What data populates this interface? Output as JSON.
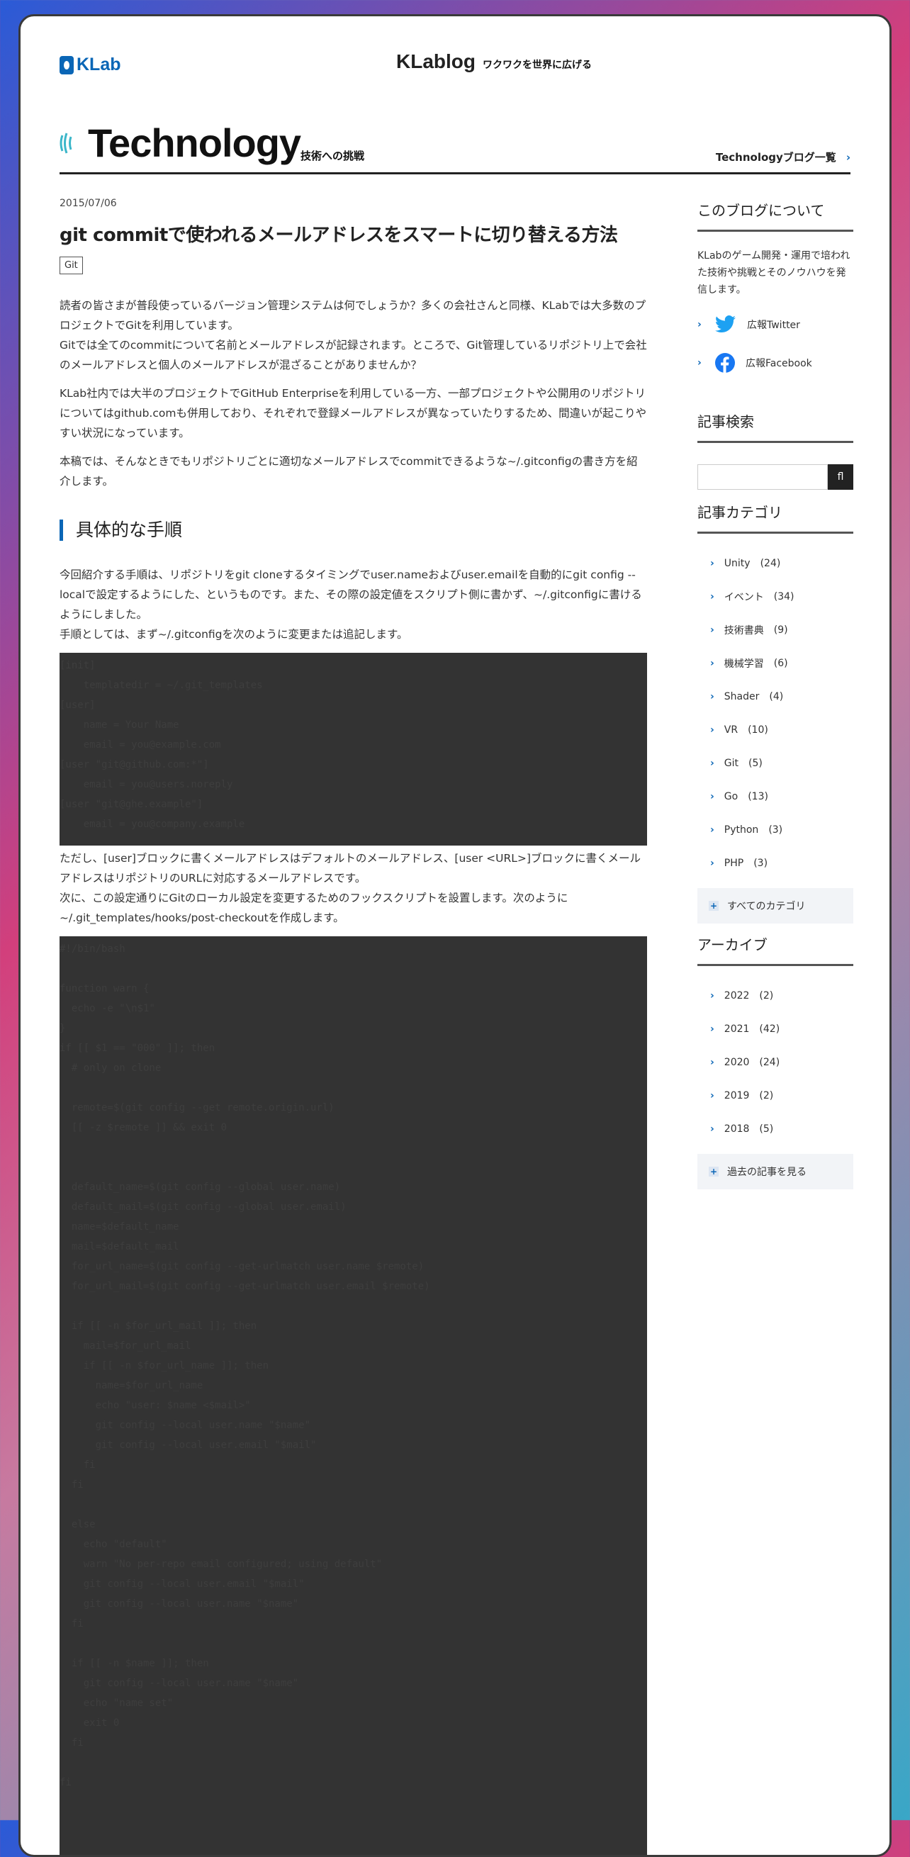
{
  "header": {
    "klab_logo": "KLab",
    "klablog_logo": "KLablog",
    "klablog_tagline": "ワクワクを世界に広げる"
  },
  "hero": {
    "title": "Technology",
    "subtitle": "技術への挑戦",
    "list_link": "Technologyブログ一覧"
  },
  "article": {
    "date": "2015/07/06",
    "title": "git commitで使われるメールアドレスをスマートに切り替える方法",
    "tag": "Git",
    "intro": [
      "読者の皆さまが普段使っているバージョン管理システムは何でしょうか？多くの会社さんと同様、KLabでは大多数のプロジェクトでGitを利用しています。",
      "Gitでは全てのcommitについて名前とメールアドレスが記録されます。ところで、Git管理しているリポジトリ上で会社のメールアドレスと個人のメールアドレスが混ざることがありませんか？",
      "KLab社内では大半のプロジェクトでGitHub Enterpriseを利用している一方、一部プロジェクトや公開用のリポジトリについてはgithub.comも併用しており、それぞれで登録メールアドレスが異なっていたりするため、間違いが起こりやすい状況になっています。",
      "本稿では、そんなときでもリポジトリごとに適切なメールアドレスでcommitできるような~/.gitconfigの書き方を紹介します。"
    ],
    "h2": "具体的な手順",
    "steps": [
      "今回紹介する手順は、リポジトリをgit cloneするタイミングでuser.nameおよびuser.emailを自動的にgit config --localで設定するようにした、というものです。また、その際の設定値をスクリプト側に書かず、~/.gitconfigに書けるようにしました。",
      "手順としては、まず~/.gitconfigを次のように変更または追記します。"
    ],
    "after_code": [
      "ただし、[user]ブロックに書くメールアドレスはデフォルトのメールアドレス、[user <URL>]ブロックに書くメールアドレスはリポジトリのURLに対応するメールアドレスです。",
      "次に、この設定通りにGitのローカル設定を変更するためのフックスクリプトを設置します。次のように~/.git_templates/hooks/post-checkoutを作成します。"
    ],
    "code1": [
      "[init]",
      "    templatedir = ~/.git_templates",
      "[user]",
      "    name = Your Name",
      "    email = you@example.com",
      "[user \"git@github.com:*\"]",
      "    email = you@users.noreply",
      "[user \"git@ghe.example\"]",
      "    email = you@company.example"
    ],
    "code2": [
      "#!/bin/bash",
      "",
      "function warn {",
      "  echo -e \"\\n$1\"",
      "}",
      "if [[ $1 == \"000\" ]]; then",
      "  # only on clone",
      "",
      "  remote=$(git config --get remote.origin.url)",
      "  [[ -z $remote ]] && exit 0",
      "",
      "  ",
      "  default_name=$(git config --global user.name)",
      "  default_mail=$(git config --global user.email)",
      "  name=$default_name",
      "  mail=$default_mail",
      "  for_url_name=$(git config --get-urlmatch user.name $remote)",
      "  for_url_mail=$(git config --get-urlmatch user.email $remote)",
      "",
      "  if [[ -n $for_url_mail ]]; then",
      "    mail=$for_url_mail",
      "    if [[ -n $for_url_name ]]; then",
      "      name=$for_url_name",
      "      echo \"user: $name <$mail>\"",
      "      git config --local user.name \"$name\"",
      "      git config --local user.email \"$mail\"",
      "    fi",
      "  fi",
      "",
      "  else",
      "    echo \"default\"",
      "    warn \"No per-repo email configured; using default\"",
      "    git config --local user.email \"$mail\"",
      "    git config --local user.name \"$name\"",
      "  fi",
      "",
      "  if [[ -n $name ]]; then",
      "    git config --local user.name \"$name\"",
      "    echo \"name set\"",
      "    exit 0",
      "  fi",
      "",
      "fi"
    ]
  },
  "sidebar": {
    "about_heading": "このブログについて",
    "about_text": "KLabのゲーム開発・運用で培われた技術や挑戦とそのノウハウを発信します。",
    "twitter_label": "広報Twitter",
    "facebook_label": "広報Facebook",
    "search_heading": "記事検索",
    "search_button": "fl",
    "category_heading": "記事カテゴリ",
    "categories": [
      {
        "name": "Unity",
        "count": "(24)"
      },
      {
        "name": "イベント",
        "count": "(34)"
      },
      {
        "name": "技術書典",
        "count": "(9)"
      },
      {
        "name": "機械学習",
        "count": "(6)"
      },
      {
        "name": "Shader",
        "count": "(4)"
      },
      {
        "name": "VR",
        "count": "(10)"
      },
      {
        "name": "Git",
        "count": "(5)"
      },
      {
        "name": "Go",
        "count": "(13)"
      },
      {
        "name": "Python",
        "count": "(3)"
      },
      {
        "name": "PHP",
        "count": "(3)"
      }
    ],
    "all_categories": "すべてのカテゴリ",
    "archive_heading": "アーカイブ",
    "archives": [
      {
        "year": "2022",
        "count": "(2)"
      },
      {
        "year": "2021",
        "count": "(42)"
      },
      {
        "year": "2020",
        "count": "(24)"
      },
      {
        "year": "2019",
        "count": "(2)"
      },
      {
        "year": "2018",
        "count": "(5)"
      }
    ],
    "past_articles": "過去の記事を見る"
  },
  "colors": {
    "accent": "#0a66b6",
    "code_bg": "#333333",
    "twitter": "#1da1f2",
    "facebook": "#1877f2"
  }
}
